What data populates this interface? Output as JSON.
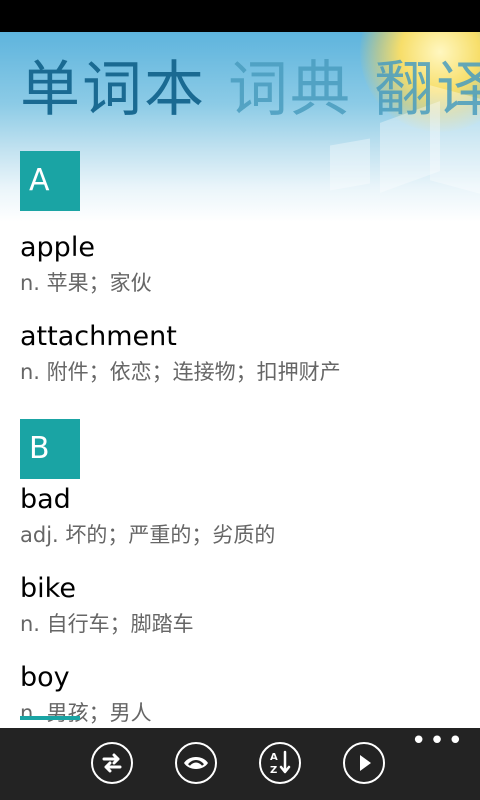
{
  "pivot": {
    "tabs": [
      "单词本",
      "词典",
      "翻译"
    ]
  },
  "groups": [
    {
      "letter": "A",
      "entries": [
        {
          "word": "apple",
          "definition": "n. 苹果；家伙"
        },
        {
          "word": "attachment",
          "definition": "n. 附件；依恋；连接物；扣押财产"
        }
      ]
    },
    {
      "letter": "B",
      "entries": [
        {
          "word": "bad",
          "definition": "adj. 坏的；严重的；劣质的"
        },
        {
          "word": "bike",
          "definition": "n. 自行车；脚踏车"
        },
        {
          "word": "boy",
          "definition": "n. 男孩；男人"
        }
      ]
    }
  ],
  "app_bar": {
    "buttons": [
      "swap-icon",
      "view-icon",
      "sort-az-icon",
      "play-icon"
    ],
    "more": "•••"
  },
  "colors": {
    "accent": "#1aa4a4",
    "pivot_active": "#1a6a92",
    "app_bar": "#232323"
  }
}
